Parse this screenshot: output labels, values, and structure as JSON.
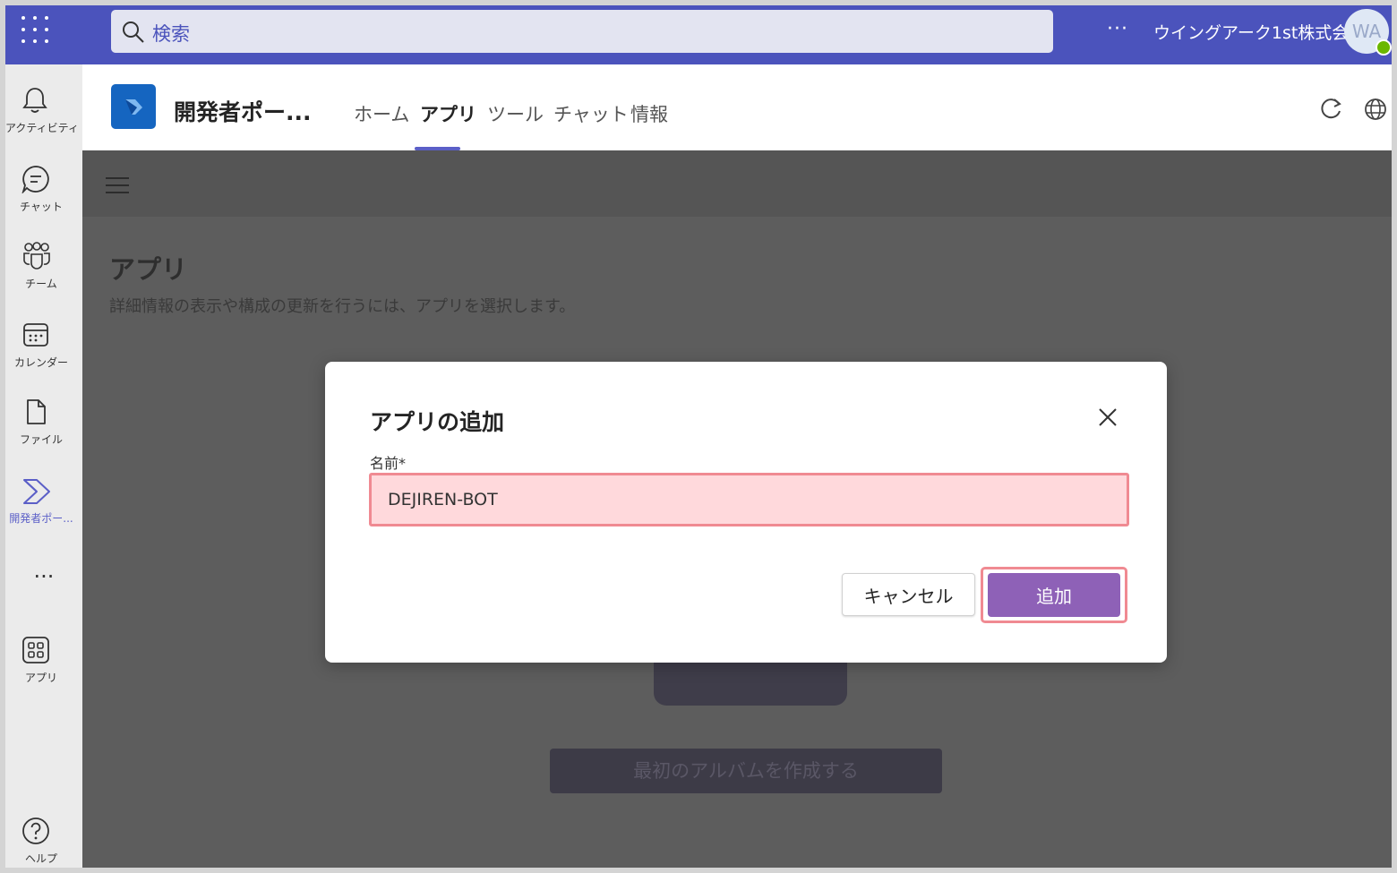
{
  "topbar": {
    "search_placeholder": "検索",
    "more": "···",
    "org_name": "ウイングアーク1st株式会社",
    "avatar_initials": "WA"
  },
  "rail": {
    "items": [
      {
        "label": "アクティビティ",
        "icon": "bell-icon"
      },
      {
        "label": "チャット",
        "icon": "chat-icon"
      },
      {
        "label": "チーム",
        "icon": "teams-icon"
      },
      {
        "label": "カレンダー",
        "icon": "calendar-icon"
      },
      {
        "label": "ファイル",
        "icon": "file-icon"
      },
      {
        "label": "開発者ポー...",
        "icon": "developer-portal-icon",
        "active": true
      }
    ],
    "more": "···",
    "apps_label": "アプリ",
    "help_label": "ヘルプ"
  },
  "app_header": {
    "title": "開発者ポー...",
    "tabs": [
      "ホーム",
      "アプリ",
      "ツール",
      "チャット",
      "情報"
    ],
    "active_tab": "アプリ"
  },
  "page": {
    "title": "アプリ",
    "description": "詳細情報の表示や構成の更新を行うには、アプリを選択します。",
    "create_album": "最初のアルバムを作成する"
  },
  "dialog": {
    "title": "アプリの追加",
    "field_label": "名前*",
    "name_value": "DEJIREN-BOT",
    "cancel_label": "キャンセル",
    "add_label": "追加"
  },
  "colors": {
    "brand": "#4b53bc",
    "accent": "#5b5fc7",
    "add_button": "#8e61b7",
    "highlight_border": "#f08a92"
  }
}
